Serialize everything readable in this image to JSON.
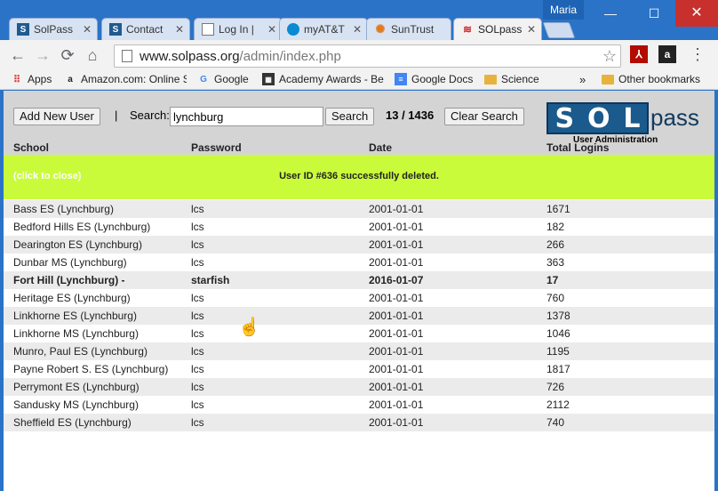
{
  "window": {
    "user": "Maria",
    "controls": {
      "minimize": "—",
      "maximize": "☐",
      "close": "✕"
    }
  },
  "tabs": [
    {
      "label": "SolPass",
      "icon": "S",
      "icon_color": "#1f5b8f"
    },
    {
      "label": "Contact",
      "icon": "S",
      "icon_color": "#1f5b8f"
    },
    {
      "label": "Log In |",
      "icon": "doc",
      "icon_color": "#777777"
    },
    {
      "label": "myAT&T",
      "icon": "att",
      "icon_color": "#0a8ad2"
    },
    {
      "label": "SunTrust",
      "icon": "sun",
      "icon_color": "#e07a1e"
    },
    {
      "label": "SOLpass",
      "icon": "sol",
      "icon_color": "#cc2222"
    }
  ],
  "toolbar": {
    "back": "←",
    "forward": "→",
    "reload": "⟳",
    "home": "⌂",
    "url_host": "www.solpass.org",
    "url_path": "/admin/index.php",
    "star": "☆",
    "ext_pdf": "⅄",
    "ext_amazon": "a",
    "menu": "⋮"
  },
  "bookmarks": {
    "apps": "Apps",
    "items": [
      {
        "label": "Amazon.com: Online S",
        "icon": "a"
      },
      {
        "label": "Google",
        "icon": "G"
      },
      {
        "label": "Academy Awards - Be",
        "icon": "film"
      },
      {
        "label": "Google Docs",
        "icon": "doc"
      },
      {
        "label": "Science",
        "icon": "folder"
      }
    ],
    "overflow": "»",
    "other": "Other bookmarks"
  },
  "admin": {
    "add_user": "Add New User",
    "separator": "|",
    "search_label": "Search:",
    "search_value": "lynchburg",
    "search_button": "Search",
    "count": "13 / 1436",
    "clear_search": "Clear Search",
    "logo_letters": [
      "S",
      "O",
      "L"
    ],
    "logo_pass": "pass",
    "logo_subtitle": "User Administration"
  },
  "table": {
    "headers": [
      "School",
      "Password",
      "Date",
      "Total Logins"
    ],
    "notice_close": "(click to close)",
    "notice_message": "User ID #636 successfully deleted.",
    "rows": [
      {
        "school": "Bass ES (Lynchburg)",
        "password": "lcs",
        "date": "2001-01-01",
        "logins": "1671"
      },
      {
        "school": "Bedford Hills ES (Lynchburg)",
        "password": "lcs",
        "date": "2001-01-01",
        "logins": "182"
      },
      {
        "school": "Dearington ES (Lynchburg)",
        "password": "lcs",
        "date": "2001-01-01",
        "logins": "266"
      },
      {
        "school": "Dunbar MS (Lynchburg)",
        "password": "lcs",
        "date": "2001-01-01",
        "logins": "363"
      },
      {
        "school": "Fort Hill (Lynchburg) -",
        "password": "starfish",
        "date": "2016-01-07",
        "logins": "17"
      },
      {
        "school": "Heritage ES (Lynchburg)",
        "password": "lcs",
        "date": "2001-01-01",
        "logins": "760"
      },
      {
        "school": "Linkhorne ES (Lynchburg)",
        "password": "lcs",
        "date": "2001-01-01",
        "logins": "1378"
      },
      {
        "school": "Linkhorne MS (Lynchburg)",
        "password": "lcs",
        "date": "2001-01-01",
        "logins": "1046"
      },
      {
        "school": "Munro, Paul ES (Lynchburg)",
        "password": "lcs",
        "date": "2001-01-01",
        "logins": "1195"
      },
      {
        "school": "Payne Robert S. ES (Lynchburg)",
        "password": "lcs",
        "date": "2001-01-01",
        "logins": "1817"
      },
      {
        "school": "Perrymont ES (Lynchburg)",
        "password": "lcs",
        "date": "2001-01-01",
        "logins": "726"
      },
      {
        "school": "Sandusky MS (Lynchburg)",
        "password": "lcs",
        "date": "2001-01-01",
        "logins": "2112"
      },
      {
        "school": "Sheffield ES (Lynchburg)",
        "password": "lcs",
        "date": "2001-01-01",
        "logins": "740"
      }
    ]
  },
  "colors": {
    "titlebar": "#2b73c7",
    "notice_bg": "#c9fb3b",
    "header_bg": "#d4d4d4",
    "logo_blue": "#1a5a8c"
  },
  "cursor": "☝"
}
